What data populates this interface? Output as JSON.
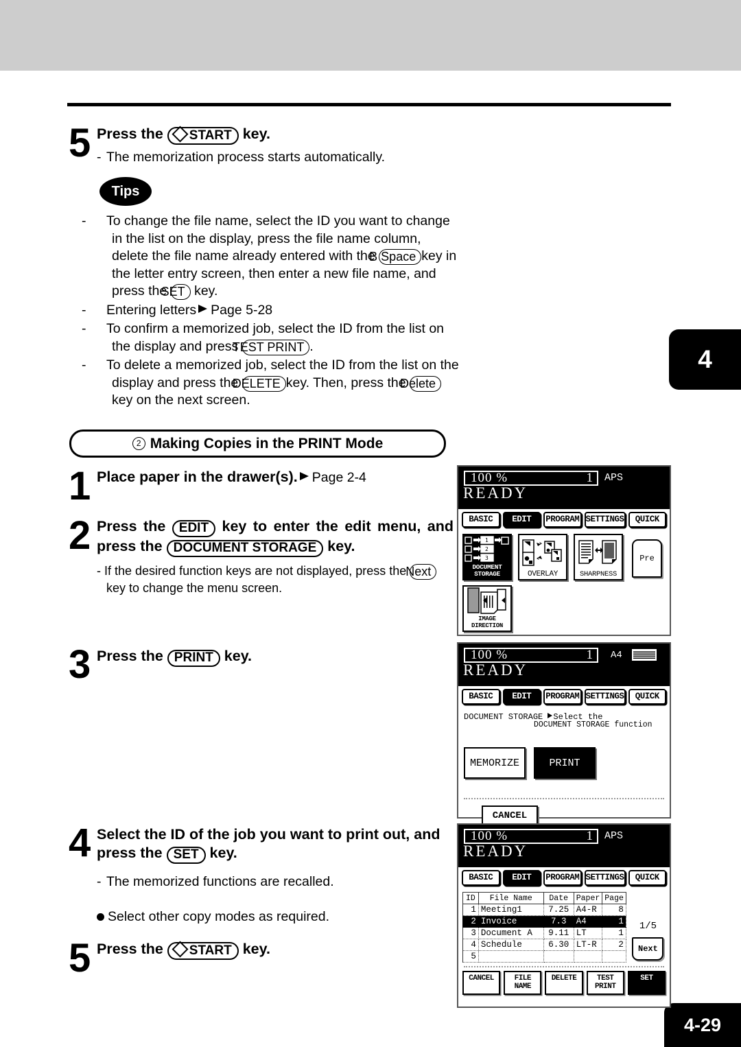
{
  "page": {
    "chapter_tab": "4",
    "page_number": "4-29"
  },
  "step5a": {
    "number": "5",
    "headline_pre": "Press the",
    "key": "START",
    "headline_post": "key.",
    "note": "The memorization process starts automatically."
  },
  "tips": {
    "badge": "Tips",
    "items": [
      {
        "parts": [
          "To change the file name, select the ID you want to change in the list on the display, press the file name column, delete the file name already entered with the",
          "B Space",
          "key in the letter entry screen, then enter a new file name, and press the",
          "SET",
          "key."
        ]
      },
      {
        "text_pre": "Entering letters",
        "page_ref": "Page 5-28"
      },
      {
        "parts": [
          "To confirm a memorized job, select the ID from the list on the display and press",
          "TEST PRINT",
          "."
        ]
      },
      {
        "parts": [
          "To delete a memorized job, select the ID from the list on the display and press the",
          "DELETE",
          "key. Then, press the",
          "Delete",
          "key on the next screen."
        ]
      }
    ]
  },
  "section": {
    "circle_number": "2",
    "title": "Making Copies in the PRINT Mode"
  },
  "step1": {
    "number": "1",
    "headline": "Place paper in the drawer(s).",
    "page_ref": "Page 2-4"
  },
  "step2": {
    "number": "2",
    "pre": "Press the",
    "key1": "EDIT",
    "mid": "key to enter the edit menu, and press the",
    "key2": "DOCUMENT STORAGE",
    "post": "key.",
    "note_pre": "If the desired function keys are not displayed, press the",
    "note_key": "Next",
    "note_post": "key to change the menu screen."
  },
  "step3": {
    "number": "3",
    "pre": "Press the",
    "key": "PRINT",
    "post": "key."
  },
  "step4": {
    "number": "4",
    "headline1": "Select the ID of the job you want to print out, and",
    "headline2_pre": "press the",
    "key": "SET",
    "headline2_post": "key.",
    "note": "The memorized functions are recalled.",
    "bullet": "Select other copy modes as required."
  },
  "step5b": {
    "number": "5",
    "headline_pre": "Press the",
    "key": "START",
    "headline_post": "key."
  },
  "lcd1": {
    "zoom": "100  %",
    "count": "1",
    "paper_mode": "APS",
    "status": "READY",
    "tabs": [
      {
        "label": "BASIC",
        "active": false
      },
      {
        "label": "EDIT",
        "active": true
      },
      {
        "label": "PROGRAM",
        "active": false
      },
      {
        "label": "SETTINGS",
        "active": false
      },
      {
        "label": "QUICK",
        "active": false
      }
    ],
    "functions": [
      {
        "label": "DOCUMENT STORAGE",
        "icon": "document-storage-icon",
        "active": true
      },
      {
        "label": "OVERLAY",
        "icon": "overlay-icon",
        "active": false
      },
      {
        "label": "SHARPNESS",
        "icon": "sharpness-icon",
        "active": false
      },
      {
        "label": "IMAGE DIRECTION",
        "icon": "image-direction-icon",
        "active": false
      }
    ],
    "prev_label": "Pre"
  },
  "lcd2": {
    "zoom": "100  %",
    "count": "1",
    "paper_size": "A4",
    "status": "READY",
    "tabs": [
      {
        "label": "BASIC",
        "active": false
      },
      {
        "label": "EDIT",
        "active": true
      },
      {
        "label": "PROGRAM",
        "active": false
      },
      {
        "label": "SETTINGS",
        "active": false
      },
      {
        "label": "QUICK",
        "active": false
      }
    ],
    "mode_label": "DOCUMENT STORAGE",
    "prompt_line1": "Select the",
    "prompt_line2": "DOCUMENT STORAGE function",
    "buttons": [
      {
        "label": "MEMORIZE",
        "active": false
      },
      {
        "label": "PRINT",
        "active": true
      }
    ],
    "cancel_label": "CANCEL"
  },
  "lcd3": {
    "zoom": "100  %",
    "count": "1",
    "paper_mode": "APS",
    "status": "READY",
    "tabs": [
      {
        "label": "BASIC",
        "active": false
      },
      {
        "label": "EDIT",
        "active": true
      },
      {
        "label": "PROGRAM",
        "active": false
      },
      {
        "label": "SETTINGS",
        "active": false
      },
      {
        "label": "QUICK",
        "active": false
      }
    ],
    "table": {
      "headers": [
        "ID",
        "File Name",
        "Date",
        "Paper",
        "Page"
      ],
      "rows": [
        {
          "id": "1",
          "name": "Meeting1",
          "date": "7.25",
          "paper": "A4-R",
          "page": "8",
          "selected": false
        },
        {
          "id": "2",
          "name": "Invoice",
          "date": "7.3",
          "paper": "A4",
          "page": "1",
          "selected": true
        },
        {
          "id": "3",
          "name": "Document A",
          "date": "9.11",
          "paper": "LT",
          "page": "1",
          "selected": false
        },
        {
          "id": "4",
          "name": "Schedule",
          "date": "6.30",
          "paper": "LT-R",
          "page": "2",
          "selected": false
        },
        {
          "id": "5",
          "name": "",
          "date": "",
          "paper": "",
          "page": "",
          "selected": false
        }
      ]
    },
    "page_indicator": "1/5",
    "next_label": "Next",
    "bottom_buttons": [
      {
        "label": "CANCEL",
        "active": false
      },
      {
        "label": "FILE NAME",
        "active": false
      },
      {
        "label": "DELETE",
        "active": false
      },
      {
        "label": "TEST PRINT",
        "active": false
      },
      {
        "label": "SET",
        "active": true
      }
    ]
  }
}
